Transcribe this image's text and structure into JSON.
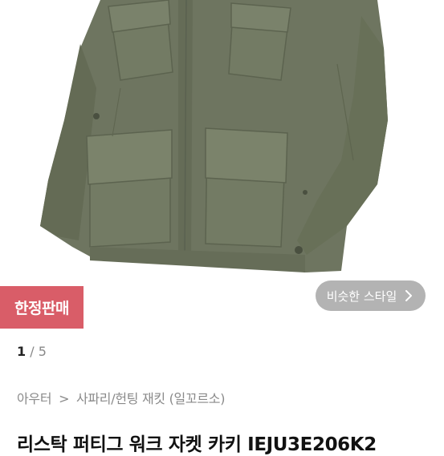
{
  "badge": {
    "label": "한정판매"
  },
  "similar_style": {
    "label": "비슷한 스타일"
  },
  "gallery": {
    "current": "1",
    "separator": "/",
    "total": "5"
  },
  "breadcrumb": {
    "items": [
      "아우터",
      "사파리/헌팅 재킷 (일꼬르소)"
    ],
    "separator": ">"
  },
  "product": {
    "title": "리스탁 퍼티그 워크 자켓 카키 IEJU3E206K2"
  },
  "colors": {
    "jacket": "#6f775e",
    "badge": "#d95d68"
  },
  "icons": {
    "similar_style_chevron": "chevron-right-icon"
  }
}
